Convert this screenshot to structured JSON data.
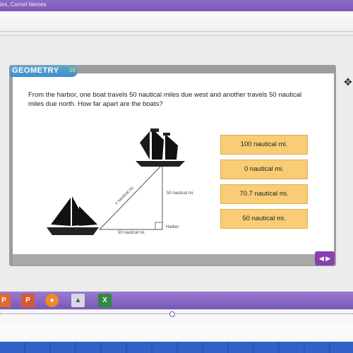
{
  "window": {
    "title": "les, Cornel Nemes"
  },
  "badge": {
    "label": "GEOMETRY",
    "number": "10"
  },
  "question": "From the harbor, one boat travels 50 nautical miles due west and another travels 50 nautical miles due north. How far apart are the boats?",
  "diagram": {
    "hyp_label": "x nautical mi.",
    "vert_label": "50 nautical mi.",
    "horiz_label": "50 nautical mi.",
    "harbor_label": "Harbor"
  },
  "answers": [
    {
      "label": "100 nautical mi."
    },
    {
      "label": "0 nautical mi."
    },
    {
      "label": "70.7 nautical mi."
    },
    {
      "label": "50 nautical mi."
    }
  ],
  "nav": {
    "arrows": "◀ ▶"
  },
  "taskbar": {
    "icons": [
      "powerpoint-icon",
      "powerpoint-icon",
      "firefox-icon",
      "app-icon",
      "excel-icon"
    ]
  },
  "colors": {
    "purple": "#7b58b8",
    "answer_bg": "#f8cd75",
    "badge_blue": "#3f8fc7"
  }
}
